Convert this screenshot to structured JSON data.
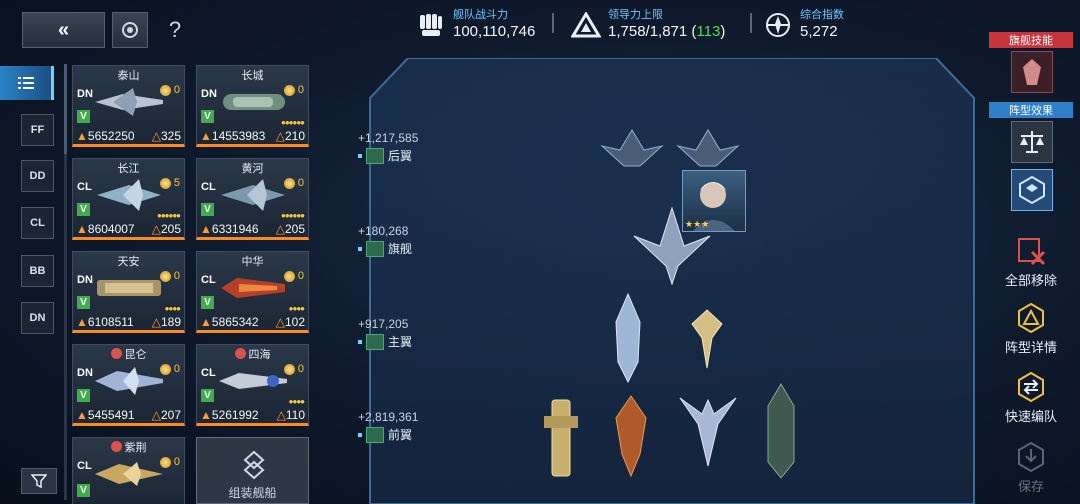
{
  "header": {
    "fleet_power_label": "舰队战斗力",
    "fleet_power_value": "100,110,746",
    "command_label": "领导力上限",
    "command_value": "1,758/1,871 (",
    "command_bonus": "113",
    "command_close": ")",
    "index_label": "综合指数",
    "index_value": "5,272"
  },
  "categories": [
    "FF",
    "DD",
    "CL",
    "BB",
    "DN"
  ],
  "ships": [
    {
      "name": "泰山",
      "rank": "DN",
      "level": "0",
      "power": "5652250",
      "cost": "325",
      "pips": ""
    },
    {
      "name": "长城",
      "rank": "DN",
      "level": "0",
      "power": "14553983",
      "cost": "210",
      "pips": "●●●●●●"
    },
    {
      "name": "长江",
      "rank": "CL",
      "level": "5",
      "power": "8604007",
      "cost": "205",
      "pips": "●●●●●●"
    },
    {
      "name": "黄河",
      "rank": "CL",
      "level": "0",
      "power": "6331946",
      "cost": "205",
      "pips": "●●●●●●"
    },
    {
      "name": "天安",
      "rank": "DN",
      "level": "0",
      "power": "6108511",
      "cost": "189",
      "pips": "●●●●"
    },
    {
      "name": "中华",
      "rank": "CL",
      "level": "0",
      "power": "5865342",
      "cost": "102",
      "pips": "●●●●"
    },
    {
      "name": "昆仑",
      "rank": "DN",
      "level": "0",
      "power": "5455491",
      "cost": "207",
      "pips": ""
    },
    {
      "name": "四海",
      "rank": "CL",
      "level": "0",
      "power": "5261992",
      "cost": "110",
      "pips": "●●●●"
    },
    {
      "name": "紫荆",
      "rank": "CL",
      "level": "0",
      "power": "",
      "cost": "",
      "pips": ""
    }
  ],
  "add_ship_label": "组装舰船",
  "formation": {
    "rear_power": "+1,217,585",
    "rear_label": "后翼",
    "flag_power": "+180,268",
    "flag_label": "旗舰",
    "main_power": "+917,205",
    "main_label": "主翼",
    "front_power": "+2,819,361",
    "front_label": "前翼",
    "captain_stars": "★★★"
  },
  "right_panel": {
    "flagship_skill": "旗舰技能",
    "formation_effect": "阵型效果",
    "remove_all": "全部移除",
    "formation_detail": "阵型详情",
    "quick_edit": "快速编队",
    "save": "保存"
  },
  "colors": {
    "accent_blue": "#6fc6ff",
    "accent_orange": "#ff8a1f",
    "bonus_green": "#4fdc5a",
    "skill_tag_red": "#c7353b",
    "effect_tag_blue": "#2f7fc9"
  }
}
